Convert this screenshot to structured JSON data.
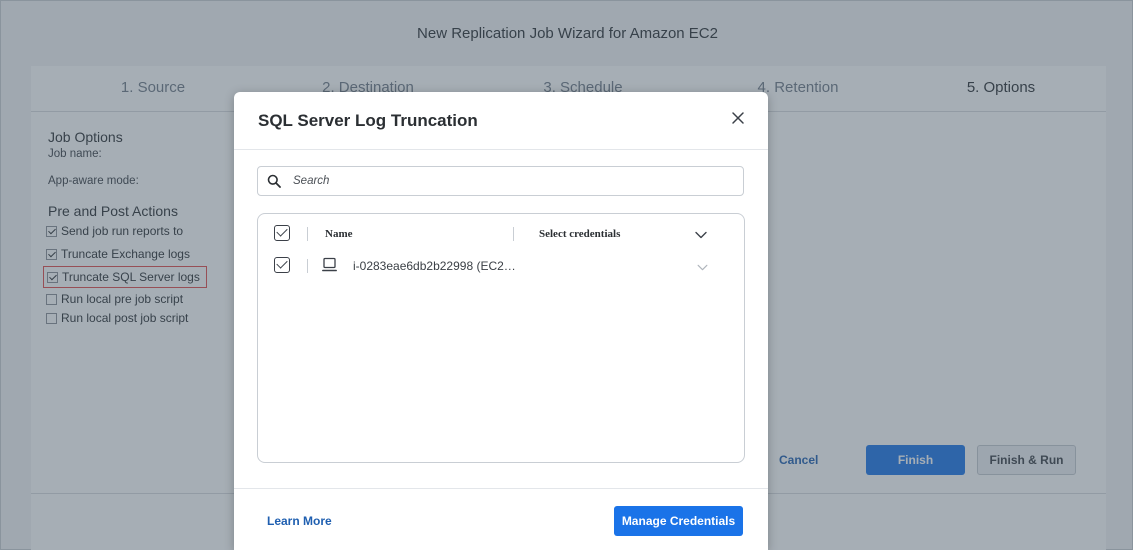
{
  "wizard": {
    "title": "New Replication Job Wizard for Amazon EC2",
    "steps": [
      "1. Source",
      "2. Destination",
      "3. Schedule",
      "4. Retention",
      "5. Options"
    ],
    "job_options_heading": "Job Options",
    "job_name_label": "Job name:",
    "app_aware_label": "App-aware mode:",
    "pre_post_heading": "Pre and Post Actions",
    "actions": [
      {
        "label": "Send job run reports to",
        "checked": true
      },
      {
        "label": "Truncate Exchange logs",
        "checked": true
      },
      {
        "label": "Truncate SQL Server logs",
        "checked": true
      },
      {
        "label": "Run local pre job script",
        "checked": false
      },
      {
        "label": "Run local post job script",
        "checked": false
      }
    ],
    "footer": {
      "cancel": "Cancel",
      "finish": "Finish",
      "finish_run": "Finish & Run"
    }
  },
  "modal": {
    "title": "SQL Server Log Truncation",
    "search_placeholder": "Search",
    "columns": {
      "name": "Name",
      "credentials": "Select credentials"
    },
    "rows": [
      {
        "name": "i-0283eae6db2b22998 (EC2…",
        "checked": true,
        "icon": "computer-icon"
      }
    ],
    "learn_more": "Learn More",
    "manage_credentials": "Manage Credentials"
  },
  "colors": {
    "primary": "#1a73e8",
    "link": "#1f5fb0",
    "highlight": "#e24a4a"
  }
}
